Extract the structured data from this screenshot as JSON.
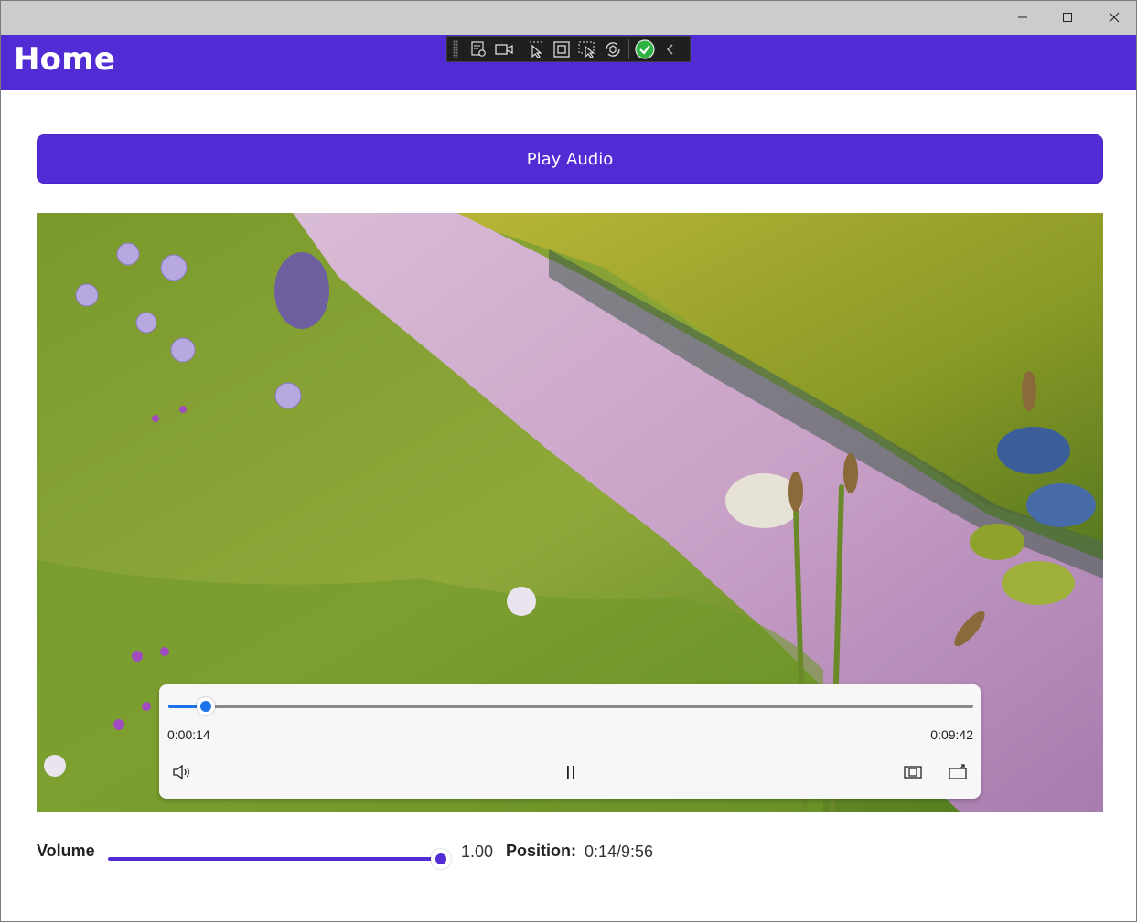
{
  "window": {
    "controls": {
      "minimize": "minimize-icon",
      "maximize": "maximize-icon",
      "close": "close-icon"
    }
  },
  "header": {
    "title": "Home",
    "background": "#512bd4"
  },
  "devtools": {
    "items": [
      "visual-tree-icon",
      "record-icon",
      "select-element-icon",
      "display-layout-icon",
      "track-focus-icon",
      "hot-reload-icon",
      "check-icon",
      "collapse-chevron-icon"
    ]
  },
  "play_button": {
    "label": "Play Audio"
  },
  "player": {
    "current_time": "0:00:14",
    "total_time": "0:09:42",
    "progress": 0.024,
    "accent": "#1a73e8",
    "buttons": {
      "volume": "volume-icon",
      "pause": "pause-icon",
      "aspect": "aspect-ratio-icon",
      "cast": "cast-icon"
    }
  },
  "bottom": {
    "volume_label": "Volume",
    "volume_value": "1.00",
    "volume_level": 1.0,
    "position_label": "Position:",
    "position_value": "0:14/9:56"
  }
}
